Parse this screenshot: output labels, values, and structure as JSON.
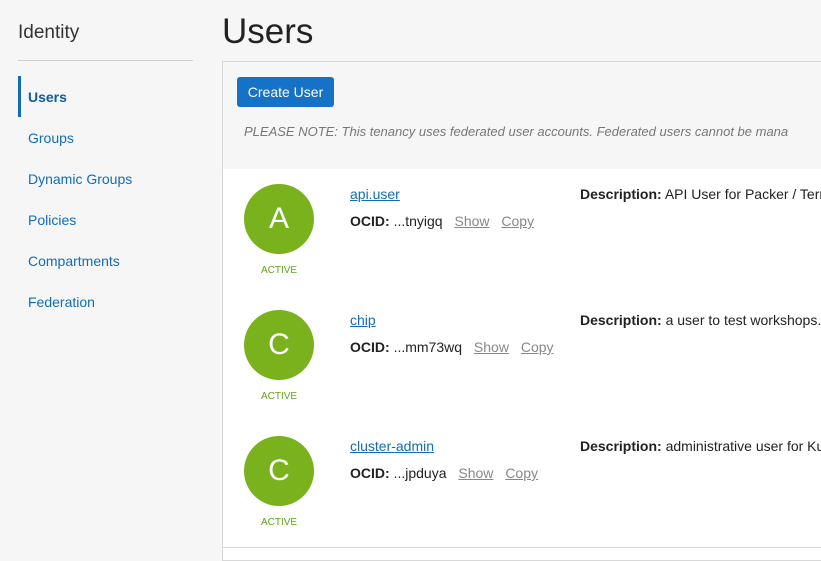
{
  "sidebar": {
    "title": "Identity",
    "items": [
      {
        "label": "Users",
        "active": true
      },
      {
        "label": "Groups"
      },
      {
        "label": "Dynamic Groups"
      },
      {
        "label": "Policies"
      },
      {
        "label": "Compartments"
      },
      {
        "label": "Federation"
      }
    ]
  },
  "page": {
    "title": "Users"
  },
  "toolbar": {
    "create_label": "Create User",
    "note": "PLEASE NOTE: This tenancy uses federated user accounts. Federated users cannot be mana"
  },
  "labels": {
    "description": "Description:",
    "ocid": "OCID:",
    "show": "Show",
    "copy": "Copy"
  },
  "users": [
    {
      "initial": "A",
      "status": "ACTIVE",
      "name": "api.user",
      "ocid": "...tnyigq",
      "description": "API User for Packer / Terr"
    },
    {
      "initial": "C",
      "status": "ACTIVE",
      "name": "chip",
      "ocid": "...mm73wq",
      "description": "a user to test workshops."
    },
    {
      "initial": "C",
      "status": "ACTIVE",
      "name": "cluster-admin",
      "ocid": "...jpduya",
      "description": "administrative user for Ku"
    }
  ],
  "colors": {
    "accent": "#1572c6",
    "avatar": "#79b21c",
    "status": "#63a31a"
  }
}
